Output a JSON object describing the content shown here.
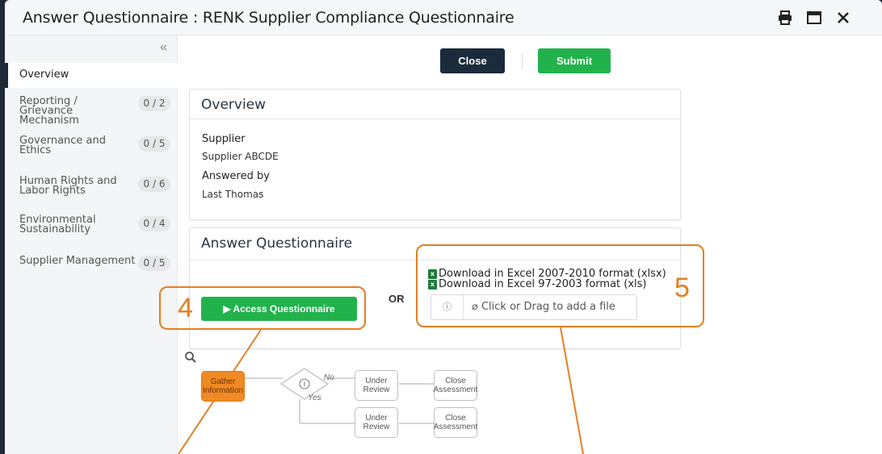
{
  "window": {
    "title": "Answer Questionnaire : RENK Supplier Compliance Questionnaire",
    "icons": [
      "print-icon",
      "maximize-icon",
      "close-icon"
    ]
  },
  "sidebar": {
    "collapse_glyph": "«",
    "items": [
      {
        "label": "Overview",
        "badge": ""
      },
      {
        "label": "Reporting / Grievance Mechanism",
        "badge": "0 / 2"
      },
      {
        "label": "Governance and Ethics",
        "badge": "0 / 5"
      },
      {
        "label": "Human Rights and Labor Rights",
        "badge": "0 / 6"
      },
      {
        "label": "Environmental Sustainability",
        "badge": "0 / 4"
      },
      {
        "label": "Supplier Management",
        "badge": "0 / 5"
      }
    ]
  },
  "toolbar": {
    "close_label": "Close",
    "submit_label": "Submit"
  },
  "overview": {
    "title": "Overview",
    "supplier_label": "Supplier",
    "supplier_value": "Supplier ABCDE",
    "answered_label": "Answered by",
    "answered_value": "Last Thomas"
  },
  "answer": {
    "title": "Answer Questionnaire",
    "access_label": "▶ Access Questionnaire",
    "or_label": "OR",
    "download_xlsx": "Download in Excel 2007-2010 format (xlsx)",
    "download_xls": "Download in Excel 97-2003 format (xls)",
    "upload_label": "Click or Drag to add a file",
    "info_glyph": "ⓘ"
  },
  "callouts": {
    "four": "4",
    "five": "5"
  },
  "workflow": {
    "gather": "Gather Information",
    "decision_no": "No",
    "decision_yes": "Yes",
    "review_1": "Under Review",
    "close_1": "Close Assessment",
    "review_2": "Under Review",
    "close_2": "Close Assessment"
  },
  "colors": {
    "accent": "#e67e22",
    "green": "#22b24c",
    "dark": "#1c2b3b"
  }
}
